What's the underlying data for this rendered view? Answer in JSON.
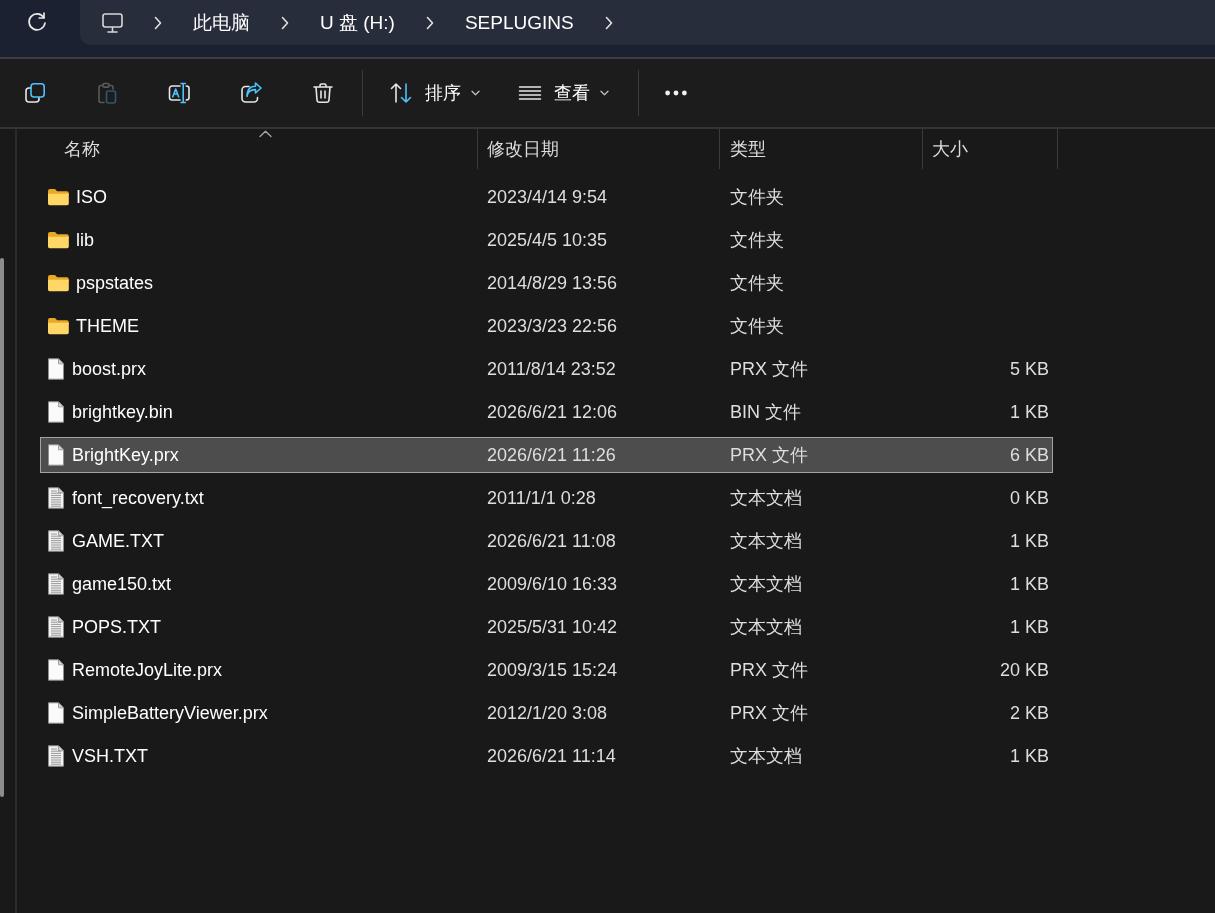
{
  "address_bar": {
    "path": [
      "此电脑",
      "U 盘 (H:)",
      "SEPLUGINS"
    ]
  },
  "toolbar": {
    "actions": [
      {
        "kind": "copy",
        "disabled": false
      },
      {
        "kind": "paste",
        "disabled": true
      },
      {
        "kind": "rename",
        "disabled": false
      },
      {
        "kind": "share",
        "disabled": false
      },
      {
        "kind": "delete",
        "disabled": false
      }
    ],
    "menus": [
      {
        "kind": "sort",
        "label": "排序"
      },
      {
        "kind": "view",
        "label": "查看"
      }
    ]
  },
  "table": {
    "columns": [
      {
        "label": "名称",
        "sorted": true
      },
      {
        "label": "修改日期",
        "sorted": false
      },
      {
        "label": "类型",
        "sorted": false
      },
      {
        "label": "大小",
        "sorted": false
      }
    ],
    "rows": [
      {
        "kind": "folder",
        "name": "ISO",
        "modified": "2023/4/14 9:54",
        "type": "文件夹",
        "selected": false
      },
      {
        "kind": "folder",
        "name": "lib",
        "modified": "2025/4/5 10:35",
        "type": "文件夹",
        "selected": false
      },
      {
        "kind": "folder",
        "name": "pspstates",
        "modified": "2014/8/29 13:56",
        "type": "文件夹",
        "selected": false
      },
      {
        "kind": "folder",
        "name": "THEME",
        "modified": "2023/3/23 22:56",
        "type": "文件夹",
        "selected": false
      },
      {
        "kind": "file",
        "name": "boost.prx",
        "modified": "2011/8/14 23:52",
        "type": "PRX 文件",
        "size": "5 KB",
        "selected": false
      },
      {
        "kind": "file",
        "name": "brightkey.bin",
        "modified": "2026/6/21 12:06",
        "type": "BIN 文件",
        "size": "1 KB",
        "selected": false
      },
      {
        "kind": "file",
        "name": "BrightKey.prx",
        "modified": "2026/6/21 11:26",
        "type": "PRX 文件",
        "size": "6 KB",
        "selected": true
      },
      {
        "kind": "text",
        "name": "font_recovery.txt",
        "modified": "2011/1/1 0:28",
        "type": "文本文档",
        "size": "0 KB",
        "selected": false
      },
      {
        "kind": "text",
        "name": "GAME.TXT",
        "modified": "2026/6/21 11:08",
        "type": "文本文档",
        "size": "1 KB",
        "selected": false
      },
      {
        "kind": "text",
        "name": "game150.txt",
        "modified": "2009/6/10 16:33",
        "type": "文本文档",
        "size": "1 KB",
        "selected": false
      },
      {
        "kind": "text",
        "name": "POPS.TXT",
        "modified": "2025/5/31 10:42",
        "type": "文本文档",
        "size": "1 KB",
        "selected": false
      },
      {
        "kind": "file",
        "name": "RemoteJoyLite.prx",
        "modified": "2009/3/15 15:24",
        "type": "PRX 文件",
        "size": "20 KB",
        "selected": false
      },
      {
        "kind": "file",
        "name": "SimpleBatteryViewer.prx",
        "modified": "2012/1/20 3:08",
        "type": "PRX 文件",
        "size": "2 KB",
        "selected": false
      },
      {
        "kind": "text",
        "name": "VSH.TXT",
        "modified": "2026/6/21 11:14",
        "type": "文本文档",
        "size": "1 KB",
        "selected": false
      }
    ]
  }
}
